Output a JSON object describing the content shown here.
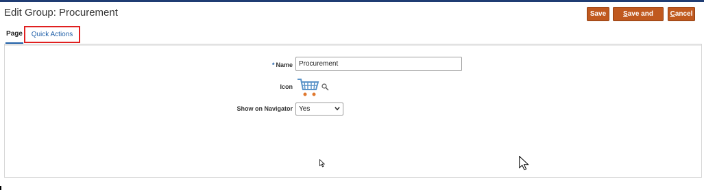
{
  "header": {
    "title": "Edit Group: Procurement"
  },
  "toolbar": {
    "save_label": "Save",
    "save_close_label": "ave and Close",
    "save_close_mnemonic": "S",
    "cancel_label": "ancel",
    "cancel_mnemonic": "C"
  },
  "tabs": [
    {
      "label": "Page",
      "selected": true
    },
    {
      "label": "Quick Actions",
      "selected": false,
      "highlighted": true
    }
  ],
  "form": {
    "name": {
      "label": "Name",
      "required_marker": "*",
      "value": "Procurement"
    },
    "icon": {
      "label": "Icon",
      "icon_name": "shopping-cart-icon"
    },
    "show_on_navigator": {
      "label": "Show on Navigator",
      "selected": "Yes"
    }
  },
  "colors": {
    "accent_button": "#c0591f",
    "link_blue": "#1f5fa8",
    "highlight_red": "#e02020",
    "header_line": "#1f3c73"
  }
}
